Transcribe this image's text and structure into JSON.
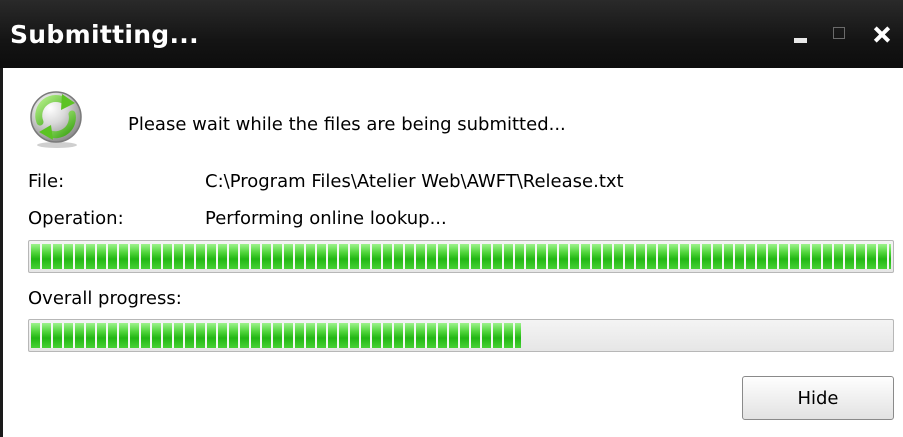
{
  "window": {
    "title": "Submitting...",
    "controls": {
      "minimize_icon": "minimize-icon",
      "maximize_icon": "maximize-icon",
      "close_icon": "close-icon"
    }
  },
  "icon": "submit-refresh-icon",
  "message": "Please wait while the files are being submitted...",
  "fields": {
    "file_label": "File:",
    "file_value": "C:\\Program Files\\Atelier Web\\AWFT\\Release.txt",
    "operation_label": "Operation:",
    "operation_value": "Performing online lookup..."
  },
  "progress": {
    "operation_fraction": 1.0,
    "overall_label": "Overall progress:",
    "overall_fraction": 0.57
  },
  "buttons": {
    "hide_label": "Hide"
  },
  "colors": {
    "titlebar": "#141414",
    "progress_fill": "#22b714"
  }
}
